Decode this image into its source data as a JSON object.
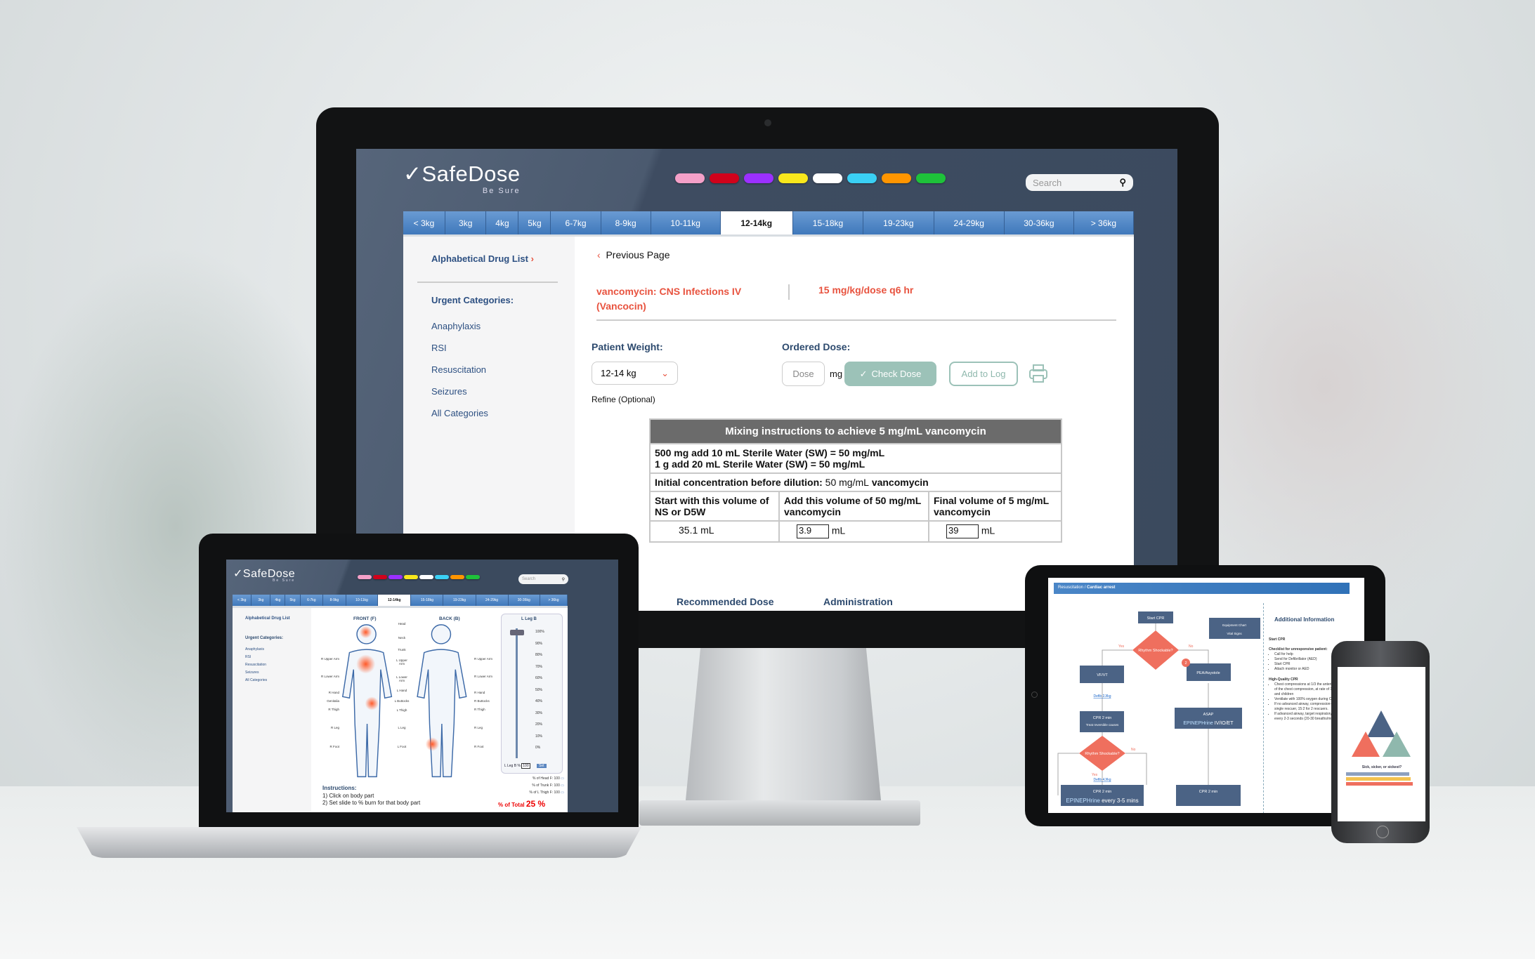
{
  "brand": {
    "name": "SafeDose",
    "tagline": "Be Sure"
  },
  "colors": {
    "accent": "#e8533f",
    "header": "#3b4a5e",
    "tab_blue": "#4a82c4",
    "check_green": "#9cc2b8"
  },
  "color_pills": [
    "#f4a0c8",
    "#d0021b",
    "#9b30ff",
    "#f8e71c",
    "#ffffff",
    "#3ad0f5",
    "#ff9500",
    "#1ec23a"
  ],
  "search": {
    "placeholder": "Search",
    "icon": "search-icon"
  },
  "weight_tabs": [
    "< 3kg",
    "3kg",
    "4kg",
    "5kg",
    "6-7kg",
    "8-9kg",
    "10-11kg",
    "12-14kg",
    "15-18kg",
    "19-23kg",
    "24-29kg",
    "30-36kg",
    "> 36kg"
  ],
  "active_tab": "12-14kg",
  "sidebar": {
    "drug_list": "Alphabetical Drug List",
    "urgent_heading": "Urgent Categories:",
    "items": [
      "Anaphylaxis",
      "RSI",
      "Resuscitation",
      "Seizures",
      "All Categories"
    ]
  },
  "main": {
    "previous": "Previous Page",
    "drug_title": "vancomycin: CNS Infections IV",
    "drug_brand": "(Vancocin)",
    "dose_rule": "15 mg/kg/dose q6 hr",
    "patient_weight_label": "Patient Weight:",
    "weight_value": "12-14 kg",
    "refine": "Refine (Optional)",
    "ordered_dose_label": "Ordered Dose:",
    "dose_placeholder": "Dose",
    "dose_unit": "mg",
    "check_dose": "Check Dose",
    "add_to_log": "Add to Log",
    "table": {
      "title": "Mixing instructions to achieve 5 mg/mL vancomycin",
      "line1": "500 mg add 10 mL Sterile Water (SW) = 50 mg/mL",
      "line2": "1 g add 20 mL Sterile Water (SW) = 50 mg/mL",
      "initial_label": "Initial concentration before dilution:",
      "initial_value": "50 mg/mL",
      "initial_suffix": "vancomycin",
      "col1": "Start with this volume of NS or D5W",
      "col2": "Add this volume of 50 mg/mL vancomycin",
      "col3": "Final volume of 5 mg/mL vancomycin",
      "val1": "35.1",
      "val2": "3.9",
      "val3": "39",
      "unit": "mL"
    },
    "lower_tabs": [
      "Recommended Dose",
      "Administration"
    ]
  },
  "laptop": {
    "front": "FRONT (F)",
    "back": "BACK (B)",
    "center_labels": [
      "Head",
      "Neck",
      "Trunk",
      "L Upper Arm",
      "L Lower Arm",
      "L Hand",
      "L Buttocks",
      "L Thigh",
      "L Leg",
      "L Foot"
    ],
    "left_labels": [
      "R Upper Arm",
      "R Lower Arm",
      "R Hand",
      "Genitalia",
      "R Thigh",
      "R Leg",
      "R Foot"
    ],
    "right_labels": [
      "R Upper Arm",
      "R Lower Arm",
      "R Hand",
      "R Buttocks",
      "R Thigh",
      "R Leg",
      "R Foot"
    ],
    "slider_title": "L Leg B",
    "slider_ticks": [
      "100%",
      "90%",
      "80%",
      "70%",
      "60%",
      "50%",
      "40%",
      "30%",
      "20%",
      "10%",
      "0%"
    ],
    "slider_value": 100,
    "slider_input_label": "L Leg B %",
    "slider_input": "100",
    "set_button": "Set",
    "percent_rows": [
      {
        "label": "% of Head F:",
        "value": "100"
      },
      {
        "label": "% of Trunk F:",
        "value": "100"
      },
      {
        "label": "% of L Thigh F:",
        "value": "100"
      }
    ],
    "total_label": "% of Total",
    "total_value": "25 %",
    "instructions_title": "Instructions:",
    "instructions": [
      "1) Click on body part",
      "2) Set slide to % burn for that body part"
    ]
  },
  "tablet": {
    "breadcrumb_parent": "Resuscitation",
    "breadcrumb_current": "Cardiac arrest",
    "nodes": {
      "start": "Start CPR",
      "rhythm": "Rhythm Shockable?",
      "yes": "Yes",
      "no": "No",
      "vfvt": "VF/VT",
      "pea": "PEA/Asystole",
      "defib1": "Defib 2J/kg",
      "cpr1": "CPR 2 min",
      "cpr1b": "Treat reversible causes",
      "asap": "ASAP",
      "epi": "EPINEPHrine",
      "route": "IV/IO/ET",
      "defib2": "Defib 4J/kg",
      "cpr2": "CPR 2 min",
      "epi_every": "every 3-5 mins",
      "cpr3": "CPR 2 min",
      "badge": "2"
    },
    "links": [
      "Equipment Chart",
      "Vital Signs"
    ],
    "info_title": "Additional Information",
    "info_start": "Start CPR",
    "checklist_title": "Checklist for unresponsive patient:",
    "checklist": [
      "Call for help",
      "Send for Defibrillator (AED)",
      "Start CPR",
      "Attach monitor or AED"
    ],
    "hq_title": "High-Quality CPR",
    "hq_items": [
      "Chest compressions at 1/3 the anterior-posterior diameter of the chest compression, at rate of 100-120/min for infants and children",
      "Ventilate with 100% oxygen during CPR.",
      "If no advanced airway, compression-to-ventilation 30:2 for single rescuer, 15:2 for 2 rescuers.",
      "If advanced airway, target respiratory rate range of 1 breath every 2-3 seconds (20-30 breaths/min)."
    ]
  },
  "phone": {
    "heading": "Sick, sicker, or sickest?"
  }
}
